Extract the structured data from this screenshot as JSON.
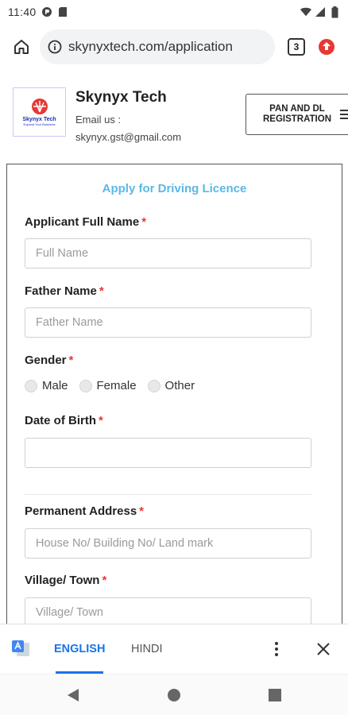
{
  "status_bar": {
    "time": "11:40"
  },
  "browser": {
    "url": "skynyxtech.com/application",
    "tab_count": "3"
  },
  "site": {
    "logo_name": "Skynyx Tech",
    "logo_tagline": "Expand Your Business",
    "brand_name": "Skynyx Tech",
    "email_label": "Email us :",
    "email_value": "skynyx.gst@gmail.com",
    "menu_button": "PAN AND DL REGISTRATION"
  },
  "form": {
    "title": "Apply for Driving Licence",
    "required_mark": "*",
    "full_name": {
      "label": "Applicant Full Name",
      "placeholder": "Full Name",
      "value": ""
    },
    "father_name": {
      "label": "Father Name",
      "placeholder": "Father Name",
      "value": ""
    },
    "gender": {
      "label": "Gender",
      "options": [
        "Male",
        "Female",
        "Other"
      ]
    },
    "dob": {
      "label": "Date of Birth",
      "placeholder": "",
      "value": ""
    },
    "address": {
      "label": "Permanent Address",
      "placeholder": "House No/ Building No/ Land mark",
      "value": ""
    },
    "village": {
      "label": "Village/ Town",
      "placeholder": "Village/ Town",
      "value": ""
    }
  },
  "translate": {
    "languages": [
      "ENGLISH",
      "HINDI"
    ],
    "active": "ENGLISH"
  },
  "colors": {
    "title_accent": "#5bb8e6",
    "required": "#e53935",
    "active_tab": "#1a73e8",
    "update_badge": "#e53935"
  }
}
